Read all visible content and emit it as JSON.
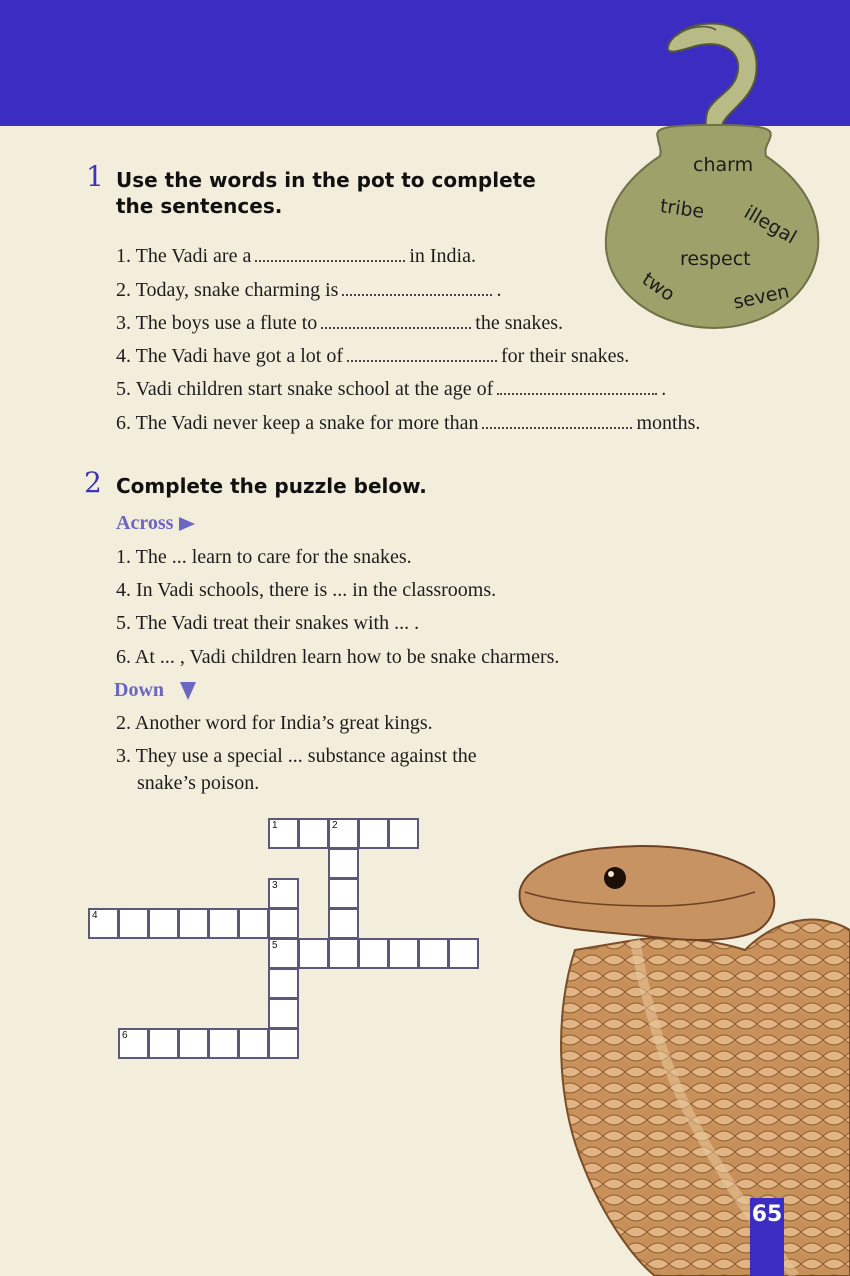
{
  "exercise1": {
    "number": "1",
    "title_line1": "Use the words in the pot to complete",
    "title_line2": "the sentences.",
    "pot_words": [
      "charm",
      "tribe",
      "illegal",
      "respect",
      "two",
      "seven"
    ],
    "sentences": [
      {
        "before": "1. The Vadi are a",
        "after": "in India."
      },
      {
        "before": "2. Today, snake charming is",
        "after": "."
      },
      {
        "before": "3. The boys use a flute to",
        "after": "the snakes."
      },
      {
        "before": "4. The Vadi have got a lot of",
        "after": "for their snakes."
      },
      {
        "before": "5. Vadi children start snake school at the age of",
        "after": "."
      },
      {
        "before": "6. The Vadi never keep a snake for more than",
        "after": "months."
      }
    ]
  },
  "exercise2": {
    "number": "2",
    "title": "Complete the puzzle below.",
    "across_label": "Across",
    "across": [
      "1. The ... learn to care for the snakes.",
      "4. In Vadi schools, there is ... in the classrooms.",
      "5. The Vadi treat their snakes with ... .",
      "6. At ... , Vadi children learn how to be snake charmers."
    ],
    "down_label": "Down",
    "down": [
      "2. Another word for India’s great kings.",
      "3. They use a special ... substance against the",
      "snake’s poison."
    ],
    "grid_numbers": [
      "1",
      "2",
      "3",
      "4",
      "5",
      "6"
    ]
  },
  "page_number": "65",
  "colors": {
    "band": "#3b2dc2",
    "accent": "#6a66c2",
    "pot": "#9ea26a",
    "page": "#f3eedc"
  }
}
